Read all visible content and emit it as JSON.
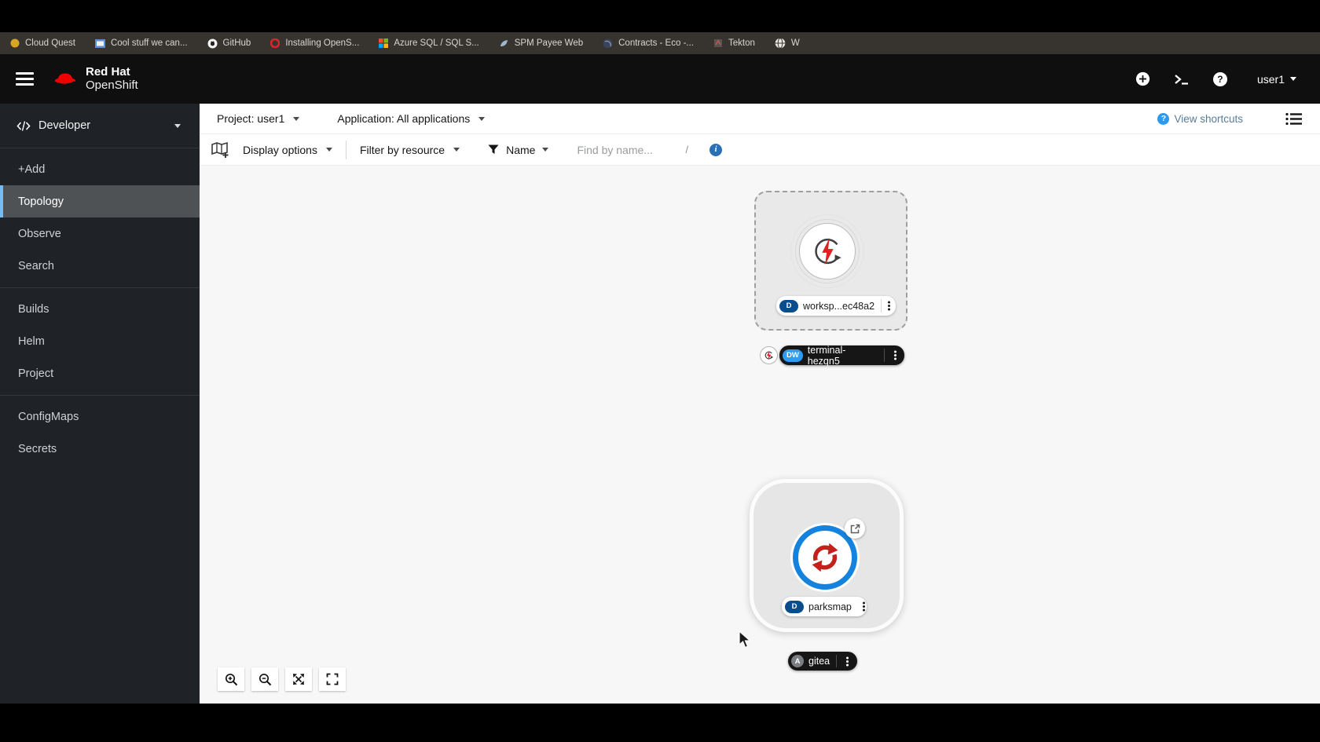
{
  "bookmarks_bar": {
    "items": [
      {
        "label": "Cloud Quest"
      },
      {
        "label": "Cool stuff we can..."
      },
      {
        "label": "GitHub"
      },
      {
        "label": "Installing OpenS..."
      },
      {
        "label": "Azure SQL / SQL S..."
      },
      {
        "label": "SPM Payee Web"
      },
      {
        "label": "Contracts - Eco -..."
      },
      {
        "label": "Tekton"
      },
      {
        "label": "W"
      }
    ]
  },
  "masthead": {
    "brand_top": "Red Hat",
    "brand_bottom": "OpenShift",
    "username": "user1",
    "help_glyph": "?"
  },
  "sidebar": {
    "perspective": "Developer",
    "items": [
      "+Add",
      "Topology",
      "Observe",
      "Search",
      "Builds",
      "Helm",
      "Project",
      "ConfigMaps",
      "Secrets"
    ],
    "active_item": "Topology"
  },
  "context_bar": {
    "project": "Project: user1",
    "application": "Application: All applications",
    "shortcuts": "View shortcuts",
    "shortcuts_glyph": "?"
  },
  "toolbar": {
    "display_options": "Display options",
    "filter_resource": "Filter by resource",
    "filter_name": "Name",
    "find_placeholder": "Find by name...",
    "slash": "/",
    "info_glyph": "i"
  },
  "topology": {
    "workspace": {
      "badge": "D",
      "label": "worksp...ec48a2"
    },
    "terminal": {
      "badge": "DW",
      "label": "terminal-hezqn5"
    },
    "parksmap": {
      "badge": "D",
      "label": "parksmap"
    },
    "gitea": {
      "badge": "A",
      "label": "gitea"
    }
  },
  "colors": {
    "accent_blue": "#2b9af3",
    "deployment_badge": "#0a4d8f",
    "devworkspace_badge": "#2f9cf4",
    "application_badge": "#7a7e82",
    "node_ring": "#1583dd",
    "brand_red": "#ee0000",
    "bolt_red": "#e0211f",
    "sync_red": "#c4211c",
    "active_nav_border": "#73bcf7"
  }
}
